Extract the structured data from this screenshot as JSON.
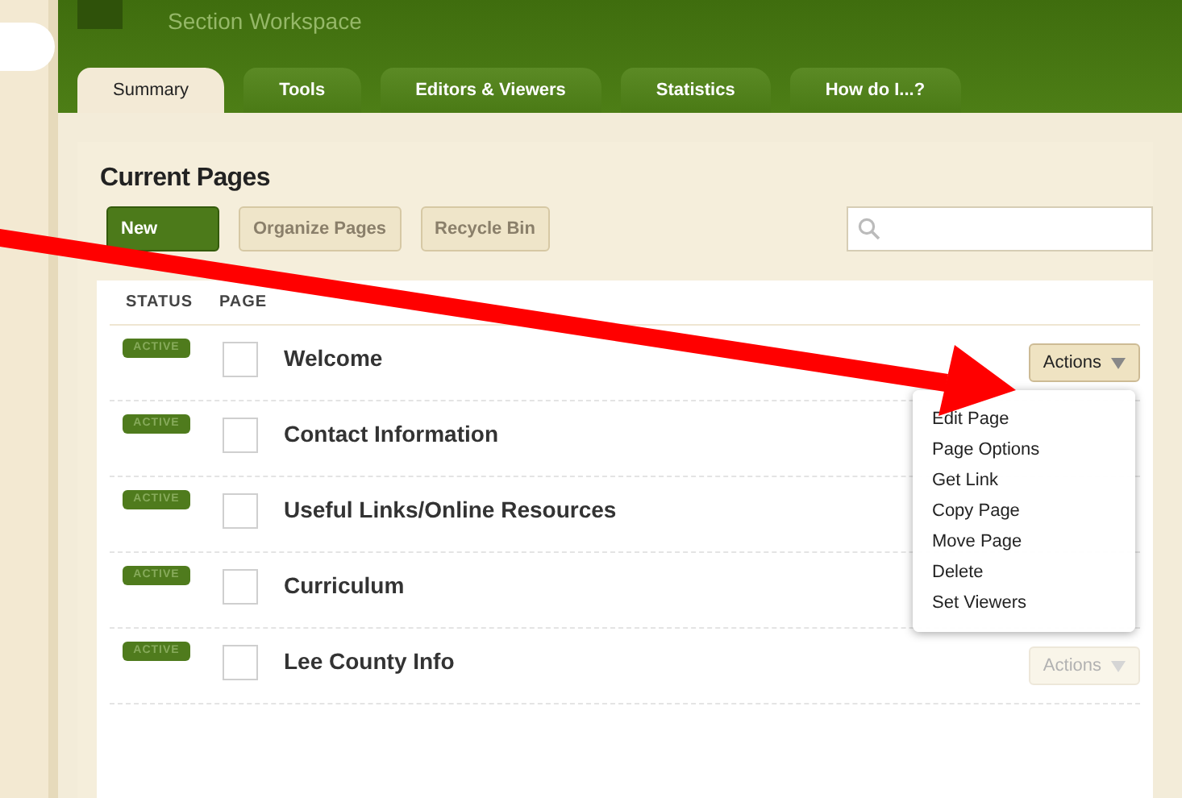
{
  "header": {
    "title": "Section Workspace"
  },
  "tabs": [
    {
      "label": "Summary",
      "selected": true
    },
    {
      "label": "Tools",
      "selected": false
    },
    {
      "label": "Editors & Viewers",
      "selected": false
    },
    {
      "label": "Statistics",
      "selected": false
    },
    {
      "label": "How do I...?",
      "selected": false
    }
  ],
  "section": {
    "title": "Current Pages",
    "buttons": [
      {
        "label": "New",
        "kind": "primary"
      },
      {
        "label": "Organize Pages",
        "kind": "secondary"
      },
      {
        "label": "Recycle Bin",
        "kind": "secondary"
      }
    ]
  },
  "table": {
    "columns": [
      "STATUS",
      "PAGE"
    ],
    "rows": [
      {
        "status": "ACTIVE",
        "page": "Welcome",
        "checked": false,
        "action": "Actions",
        "expanded": true
      },
      {
        "status": "ACTIVE",
        "page": "Contact Information",
        "checked": false
      },
      {
        "status": "ACTIVE",
        "page": "Useful Links/Online Resources",
        "checked": false
      },
      {
        "status": "ACTIVE",
        "page": "Curriculum",
        "checked": false
      },
      {
        "status": "ACTIVE",
        "page": "Lee County Info",
        "checked": false,
        "action": "Actions",
        "expanded": false
      }
    ]
  },
  "menu": {
    "items": [
      "Edit Page",
      "Page Options",
      "Get Link",
      "Copy Page",
      "Move Page",
      "Delete",
      "Set Viewers"
    ]
  }
}
